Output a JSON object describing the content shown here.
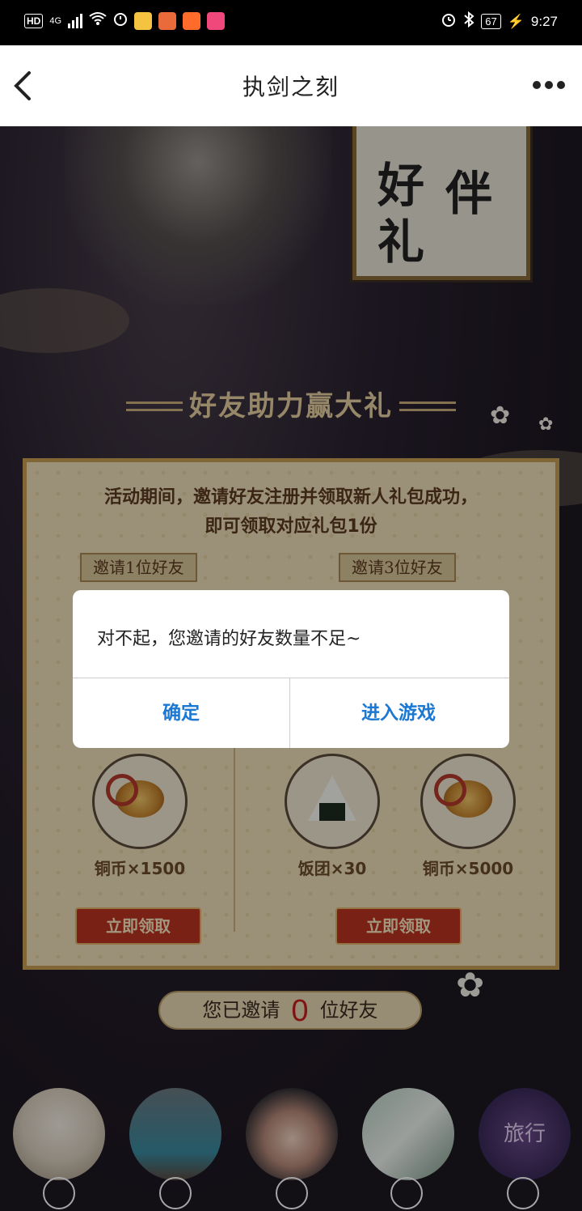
{
  "status_bar": {
    "network_type": "4G",
    "hd": "HD",
    "battery": "67",
    "time": "9:27"
  },
  "header": {
    "title": "执剑之刻"
  },
  "banner": {
    "plaque_chars": [
      "好",
      "礼",
      "伴"
    ]
  },
  "section": {
    "title": "好友助力赢大礼"
  },
  "panel": {
    "description_line1": "活动期间，邀请好友注册并领取新人礼包成功，",
    "description_line2": "即可领取对应礼包1份",
    "tier1_tag": "邀请1位好友",
    "tier3_tag": "邀请3位好友",
    "rewards": [
      {
        "label": "铜币×1500",
        "icon": "coins-icon"
      },
      {
        "label": "饭团×30",
        "icon": "riceball-icon"
      },
      {
        "label": "铜币×5000",
        "icon": "coins-icon"
      }
    ],
    "claim_label_left": "立即领取",
    "claim_label_right": "立即领取"
  },
  "invited": {
    "prefix": "您已邀请",
    "count": "0",
    "suffix": "位好友"
  },
  "avatars": {
    "last_avatar_text": "旅行"
  },
  "dialog": {
    "message": "对不起，您邀请的好友数量不足~",
    "confirm_label": "确定",
    "enter_game_label": "进入游戏"
  },
  "colors": {
    "accent_blue": "#1c78d3",
    "claim_red": "#b8341f",
    "invite_count_red": "#c81e1e",
    "panel_gold": "#c79f53"
  }
}
